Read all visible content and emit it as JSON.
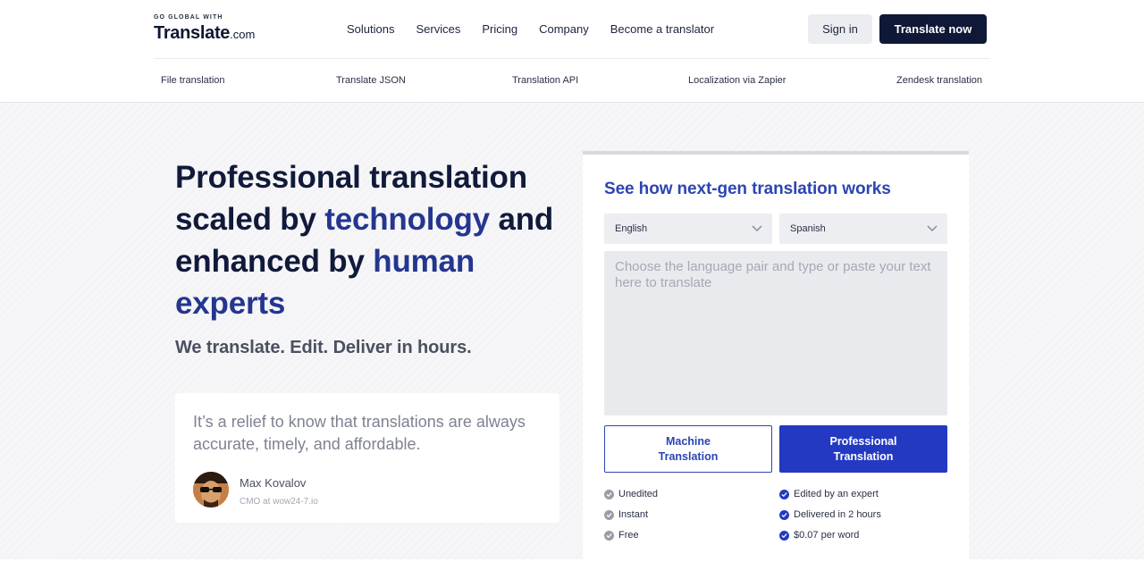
{
  "brand": {
    "tagline_small": "GO GLOBAL WITH",
    "name": "Translate",
    "tld": ".com"
  },
  "nav": {
    "items": [
      "Solutions",
      "Services",
      "Pricing",
      "Company",
      "Become a translator"
    ],
    "signin_label": "Sign in",
    "cta_label": "Translate now"
  },
  "subnav": {
    "items": [
      "File translation",
      "Translate JSON",
      "Translation API",
      "Localization via Zapier",
      "Zendesk translation"
    ]
  },
  "hero": {
    "headline": {
      "part1": "Professional translation scaled by ",
      "accent1": "technology",
      "part2": " and enhanced by ",
      "accent2": "human experts"
    },
    "tagline": "We translate. Edit. Deliver in hours.",
    "testimonial": {
      "quote": "It’s a relief to know that translations are always accurate, timely, and affordable.",
      "author": "Max Kovalov",
      "role": "CMO at wow24-7.io"
    }
  },
  "widget": {
    "title": "See how next-gen translation works",
    "source_language": "English",
    "target_language": "Spanish",
    "textarea_placeholder": "Choose the language pair and type or paste your text here to translate",
    "textarea_value": "",
    "machine_button": {
      "line1": "Machine",
      "line2": "Translation"
    },
    "pro_button": {
      "line1": "Professional",
      "line2": "Translation"
    },
    "machine_features": [
      "Unedited",
      "Instant",
      "Free"
    ],
    "pro_features": [
      "Edited by an expert",
      "Delivered in 2 hours",
      "$0.07 per word"
    ]
  },
  "colors": {
    "accent_blue": "#2439c2",
    "headline_accent": "#24368f",
    "dark_navy": "#0f1836",
    "feature_gray": "#9a9da7"
  },
  "icons": {
    "select_chevron": "chevron-down-icon",
    "feature_check": "check-circle-icon"
  }
}
